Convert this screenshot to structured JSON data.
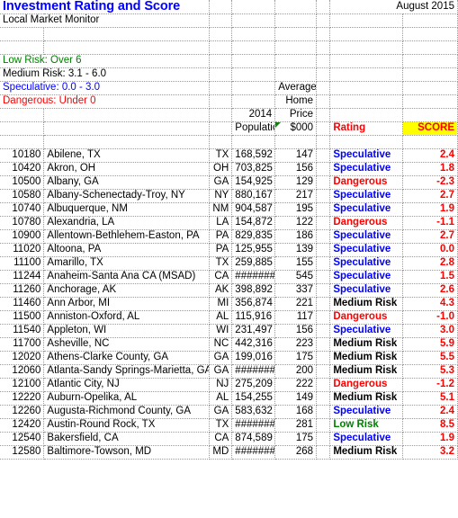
{
  "header": {
    "title": "Investment Rating and Score",
    "date": "August 2015",
    "subtitle": "Local Market Monitor"
  },
  "legend": [
    {
      "label": "Low Risk: Over 6",
      "color": "#008000",
      "key": "low"
    },
    {
      "label": "Medium Risk: 3.1 - 6.0",
      "color": "#000000",
      "key": "medium"
    },
    {
      "label": "Speculative: 0.0 - 3.0",
      "color": "#0000ff",
      "key": "speculative"
    },
    {
      "label": "Dangerous: Under 0",
      "color": "#ff0000",
      "key": "dangerous"
    }
  ],
  "column_headers": {
    "average": "Average",
    "home": "Home",
    "price": "Price",
    "year": "2014",
    "population": "Population",
    "price_units": "$000",
    "rating": "Rating",
    "score": "SCORE",
    "score_bg": "#ffff00",
    "rating_color": "#ff0000"
  },
  "rows": [
    {
      "id": "10180",
      "name": "Abilene, TX",
      "state": "TX",
      "population": "168,592",
      "price": "147",
      "rating": "Speculative",
      "rating_key": "Speculative",
      "score": "2.4"
    },
    {
      "id": "10420",
      "name": "Akron, OH",
      "state": "OH",
      "population": "703,825",
      "price": "156",
      "rating": "Speculative",
      "rating_key": "Speculative",
      "score": "1.8"
    },
    {
      "id": "10500",
      "name": "Albany, GA",
      "state": "GA",
      "population": "154,925",
      "price": "129",
      "rating": "Dangerous",
      "rating_key": "Dangerous",
      "score": "-2.3"
    },
    {
      "id": "10580",
      "name": "Albany-Schenectady-Troy, NY",
      "state": "NY",
      "population": "880,167",
      "price": "217",
      "rating": "Speculative",
      "rating_key": "Speculative",
      "score": "2.7"
    },
    {
      "id": "10740",
      "name": "Albuquerque, NM",
      "state": "NM",
      "population": "904,587",
      "price": "195",
      "rating": "Speculative",
      "rating_key": "Speculative",
      "score": "1.9"
    },
    {
      "id": "10780",
      "name": "Alexandria, LA",
      "state": "LA",
      "population": "154,872",
      "price": "122",
      "rating": "Dangerous",
      "rating_key": "Dangerous",
      "score": "-1.1"
    },
    {
      "id": "10900",
      "name": "Allentown-Bethlehem-Easton, PA",
      "state": "PA",
      "population": "829,835",
      "price": "186",
      "rating": "Speculative",
      "rating_key": "Speculative",
      "score": "2.7"
    },
    {
      "id": "11020",
      "name": "Altoona, PA",
      "state": "PA",
      "population": "125,955",
      "price": "139",
      "rating": "Speculative",
      "rating_key": "Speculative",
      "score": "0.0"
    },
    {
      "id": "11100",
      "name": "Amarillo, TX",
      "state": "TX",
      "population": "259,885",
      "price": "155",
      "rating": "Speculative",
      "rating_key": "Speculative",
      "score": "2.8"
    },
    {
      "id": "11244",
      "name": "Anaheim-Santa Ana CA (MSAD)",
      "state": "CA",
      "population": "########",
      "price": "545",
      "rating": "Speculative",
      "rating_key": "Speculative",
      "score": "1.5"
    },
    {
      "id": "11260",
      "name": "Anchorage, AK",
      "state": "AK",
      "population": "398,892",
      "price": "337",
      "rating": "Speculative",
      "rating_key": "Speculative",
      "score": "2.6"
    },
    {
      "id": "11460",
      "name": "Ann Arbor, MI",
      "state": "MI",
      "population": "356,874",
      "price": "221",
      "rating": "Medium Risk",
      "rating_key": "Medium",
      "score": "4.3"
    },
    {
      "id": "11500",
      "name": "Anniston-Oxford, AL",
      "state": "AL",
      "population": "115,916",
      "price": "117",
      "rating": "Dangerous",
      "rating_key": "Dangerous",
      "score": "-1.0"
    },
    {
      "id": "11540",
      "name": "Appleton, WI",
      "state": "WI",
      "population": "231,497",
      "price": "156",
      "rating": "Speculative",
      "rating_key": "Speculative",
      "score": "3.0"
    },
    {
      "id": "11700",
      "name": "Asheville, NC",
      "state": "NC",
      "population": "442,316",
      "price": "223",
      "rating": "Medium Risk",
      "rating_key": "Medium",
      "score": "5.9"
    },
    {
      "id": "12020",
      "name": "Athens-Clarke County, GA",
      "state": "GA",
      "population": "199,016",
      "price": "175",
      "rating": "Medium Risk",
      "rating_key": "Medium",
      "score": "5.5"
    },
    {
      "id": "12060",
      "name": "Atlanta-Sandy Springs-Marietta, GA",
      "state": "GA",
      "population": "########",
      "price": "200",
      "rating": "Medium Risk",
      "rating_key": "Medium",
      "score": "5.3"
    },
    {
      "id": "12100",
      "name": "Atlantic City, NJ",
      "state": "NJ",
      "population": "275,209",
      "price": "222",
      "rating": "Dangerous",
      "rating_key": "Dangerous",
      "score": "-1.2"
    },
    {
      "id": "12220",
      "name": "Auburn-Opelika, AL",
      "state": "AL",
      "population": "154,255",
      "price": "149",
      "rating": "Medium Risk",
      "rating_key": "Medium",
      "score": "5.1"
    },
    {
      "id": "12260",
      "name": "Augusta-Richmond County, GA",
      "state": "GA",
      "population": "583,632",
      "price": "168",
      "rating": "Speculative",
      "rating_key": "Speculative",
      "score": "2.4"
    },
    {
      "id": "12420",
      "name": "Austin-Round Rock, TX",
      "state": "TX",
      "population": "########",
      "price": "281",
      "rating": "Low Risk",
      "rating_key": "Low",
      "score": "8.5"
    },
    {
      "id": "12540",
      "name": "Bakersfield, CA",
      "state": "CA",
      "population": "874,589",
      "price": "175",
      "rating": "Speculative",
      "rating_key": "Speculative",
      "score": "1.9"
    },
    {
      "id": "12580",
      "name": "Baltimore-Towson, MD",
      "state": "MD",
      "population": "########",
      "price": "268",
      "rating": "Medium Risk",
      "rating_key": "Medium",
      "score": "3.2"
    }
  ]
}
